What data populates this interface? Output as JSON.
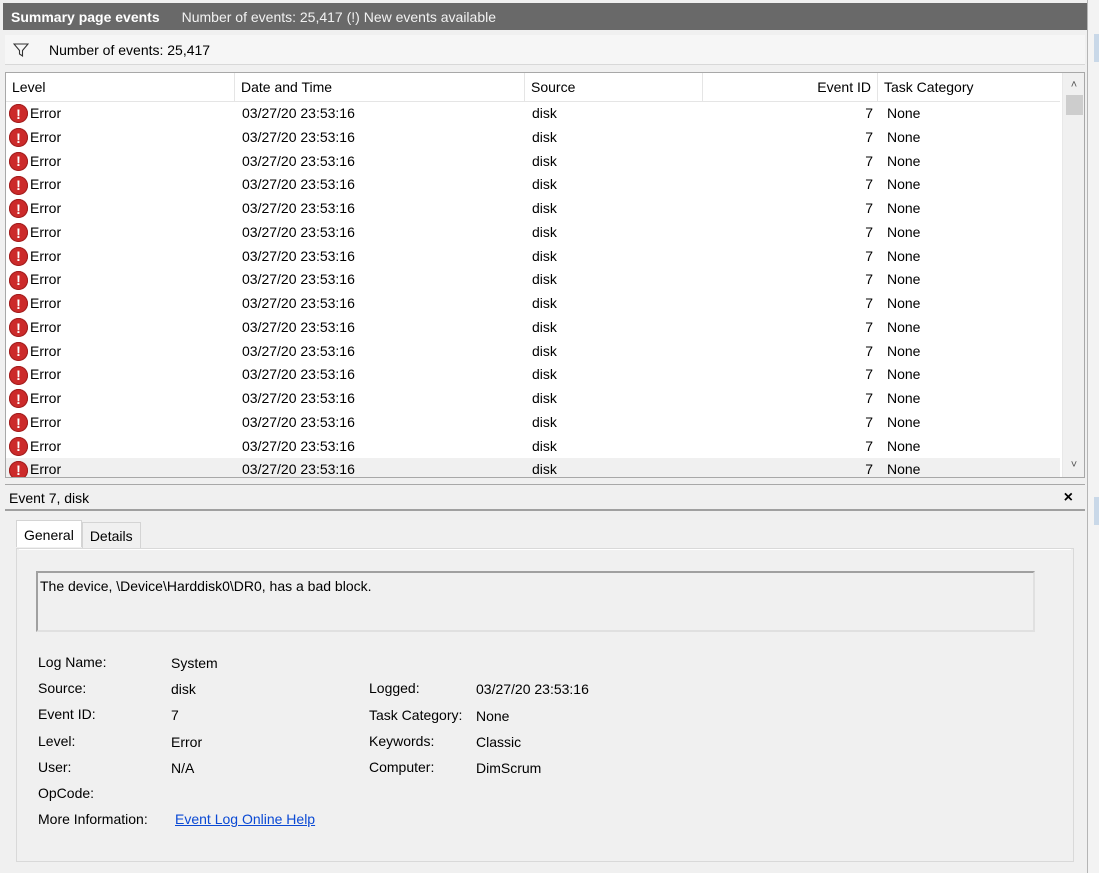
{
  "header": {
    "title": "Summary page events",
    "subtitle": "Number of events: 25,417 (!) New events available"
  },
  "filter": {
    "icon": "filter-icon",
    "count_text": "Number of events: 25,417"
  },
  "list": {
    "columns": {
      "level": "Level",
      "date": "Date and Time",
      "source": "Source",
      "event_id": "Event ID",
      "task": "Task Category"
    },
    "rows": [
      {
        "level": "Error",
        "date": "03/27/20 23:53:16",
        "source": "disk",
        "event_id": "7",
        "task": "None"
      },
      {
        "level": "Error",
        "date": "03/27/20 23:53:16",
        "source": "disk",
        "event_id": "7",
        "task": "None"
      },
      {
        "level": "Error",
        "date": "03/27/20 23:53:16",
        "source": "disk",
        "event_id": "7",
        "task": "None"
      },
      {
        "level": "Error",
        "date": "03/27/20 23:53:16",
        "source": "disk",
        "event_id": "7",
        "task": "None"
      },
      {
        "level": "Error",
        "date": "03/27/20 23:53:16",
        "source": "disk",
        "event_id": "7",
        "task": "None"
      },
      {
        "level": "Error",
        "date": "03/27/20 23:53:16",
        "source": "disk",
        "event_id": "7",
        "task": "None"
      },
      {
        "level": "Error",
        "date": "03/27/20 23:53:16",
        "source": "disk",
        "event_id": "7",
        "task": "None"
      },
      {
        "level": "Error",
        "date": "03/27/20 23:53:16",
        "source": "disk",
        "event_id": "7",
        "task": "None"
      },
      {
        "level": "Error",
        "date": "03/27/20 23:53:16",
        "source": "disk",
        "event_id": "7",
        "task": "None"
      },
      {
        "level": "Error",
        "date": "03/27/20 23:53:16",
        "source": "disk",
        "event_id": "7",
        "task": "None"
      },
      {
        "level": "Error",
        "date": "03/27/20 23:53:16",
        "source": "disk",
        "event_id": "7",
        "task": "None"
      },
      {
        "level": "Error",
        "date": "03/27/20 23:53:16",
        "source": "disk",
        "event_id": "7",
        "task": "None"
      },
      {
        "level": "Error",
        "date": "03/27/20 23:53:16",
        "source": "disk",
        "event_id": "7",
        "task": "None"
      },
      {
        "level": "Error",
        "date": "03/27/20 23:53:16",
        "source": "disk",
        "event_id": "7",
        "task": "None"
      },
      {
        "level": "Error",
        "date": "03/27/20 23:53:16",
        "source": "disk",
        "event_id": "7",
        "task": "None"
      },
      {
        "level": "Error",
        "date": "03/27/20 23:53:16",
        "source": "disk",
        "event_id": "7",
        "task": "None"
      }
    ],
    "error_icon_glyph": "!",
    "error_icon_color": "#cc2a2a"
  },
  "detail": {
    "title": "Event 7, disk",
    "close_glyph": "×",
    "tabs": [
      "General",
      "Details"
    ],
    "description": "The device, \\Device\\Harddisk0\\DR0, has a bad block.",
    "log_name": {
      "label": "Log Name:",
      "value": "System"
    },
    "source": {
      "label": "Source:",
      "value": "disk"
    },
    "event_id": {
      "label": "Event ID:",
      "value": "7"
    },
    "level": {
      "label": "Level:",
      "value": "Error"
    },
    "user": {
      "label": "User:",
      "value": "N/A"
    },
    "opcode": {
      "label": "OpCode:",
      "value": ""
    },
    "more_info": {
      "label": "More Information:",
      "value": "Event Log Online Help"
    },
    "logged": {
      "label": "Logged:",
      "value": "03/27/20 23:53:16"
    },
    "task_category": {
      "label": "Task Category:",
      "value": "None"
    },
    "keywords": {
      "label": "Keywords:",
      "value": "Classic"
    },
    "computer": {
      "label": "Computer:",
      "value": "DimScrum"
    }
  },
  "colors": {
    "header_bg": "#696969",
    "link": "#0a49d4"
  }
}
